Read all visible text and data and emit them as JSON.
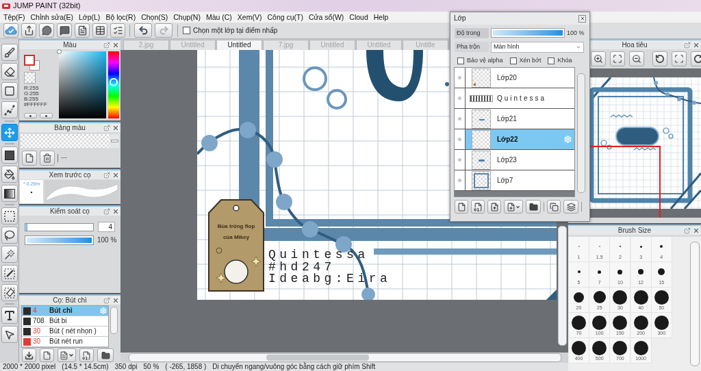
{
  "window": {
    "title": "JUMP PAINT (32bit)"
  },
  "menu": [
    "Tệp(F)",
    "Chỉnh sửa(E)",
    "Lớp(L)",
    "Bộ lọc(R)",
    "Chọn(S)",
    "Chụp(N)",
    "Màu (C)",
    "Xem(V)",
    "Công cụ(T)",
    "Cửa sổ(W)",
    "Cloud",
    "Help"
  ],
  "toolbar": {
    "buttons": [
      {
        "kind": "cloud"
      },
      {
        "kind": "share"
      },
      {
        "kind": "bubble"
      },
      {
        "kind": "comment"
      },
      {
        "kind": "page"
      },
      {
        "kind": "list"
      },
      {
        "kind": "checklist"
      }
    ],
    "undo": {
      "disabled": false
    },
    "redo": {
      "disabled": true
    },
    "pick_layer": {
      "label": "Chọn một lớp tại điểm nhấp",
      "checked": false
    }
  },
  "tools": [
    {
      "kind": "brush",
      "selected": false
    },
    {
      "kind": "eraser",
      "selected": false
    },
    {
      "kind": "shape",
      "selected": false
    },
    {
      "kind": "polyline",
      "selected": false
    },
    {
      "kind": "move",
      "selected": true
    },
    {
      "kind": "fill",
      "selected": false
    },
    {
      "kind": "bucket",
      "selected": false
    },
    {
      "kind": "gradient",
      "selected": false
    },
    {
      "kind": "marquee",
      "selected": false
    },
    {
      "kind": "lasso",
      "selected": false
    },
    {
      "kind": "wand",
      "selected": false
    },
    {
      "kind": "selpen",
      "selected": false
    },
    {
      "kind": "seleraser",
      "selected": false
    },
    {
      "kind": "text",
      "selected": false
    },
    {
      "kind": "operation",
      "selected": false
    }
  ],
  "color_panel": {
    "title": "Màu",
    "rgb": [
      "R:255",
      "G:255",
      "B:255"
    ],
    "hex": "#FFFFFF",
    "hue": {
      "level": 0.54
    }
  },
  "palette_panel": {
    "title": "Bảng màu",
    "name": "---"
  },
  "brush_preview": {
    "title": "Xem trước cọ",
    "size": "* 0.29m"
  },
  "brush_control": {
    "title": "Kiểm soát cọ",
    "size": {
      "level": 0.03,
      "value": "4"
    },
    "opacity": {
      "level": 1,
      "reading": "100 %"
    }
  },
  "brushes": {
    "title": "Cọ: Bút chì",
    "items": [
      {
        "color": "#2b2b2b",
        "size": "4",
        "size_flagged": true,
        "name": "Bút chì",
        "selected": true
      },
      {
        "color": "#2b2b2b",
        "size": "708",
        "size_flagged": false,
        "name": "Bút bi",
        "selected": false
      },
      {
        "color": "#2b2b2b",
        "size": "30",
        "size_flagged": true,
        "name": "Bút ( nét nhọn )",
        "selected": false
      },
      {
        "color": "#e53935",
        "size": "30",
        "size_flagged": true,
        "name": "Bút nét run",
        "selected": false
      }
    ]
  },
  "tabs": [
    {
      "label": "2.jpg",
      "selected": false
    },
    {
      "label": "Untitled",
      "selected": false
    },
    {
      "label": "Untitled",
      "selected": true
    },
    {
      "label": "7.jpg",
      "selected": false
    },
    {
      "label": "Untitled",
      "selected": false
    },
    {
      "label": "Untitled",
      "selected": false
    },
    {
      "label": "Untitle",
      "selected": false
    }
  ],
  "canvas": {
    "tag": [
      "Bùa trống flop",
      "của Mikey"
    ],
    "caption": [
      "Quintessa",
      "#hd247",
      "Ideabg:Eira"
    ]
  },
  "layers_window": {
    "title": "Lớp",
    "opacity": {
      "label": "Độ trong",
      "level": 1,
      "reading": "100 %"
    },
    "blend": {
      "label": "Pha trộn",
      "value": "Màn hình"
    },
    "options": [
      {
        "label": "Bảo vệ alpha",
        "checked": false
      },
      {
        "label": "Xén bớt",
        "checked": false
      },
      {
        "label": "Khóa",
        "checked": false
      }
    ],
    "layers": [
      {
        "kind": "raster",
        "name": "Lớp20",
        "selected": false
      },
      {
        "kind": "text",
        "name": "Quintessa",
        "selected": false
      },
      {
        "kind": "raster",
        "name": "Lớp21",
        "selected": false
      },
      {
        "kind": "raster",
        "name": "Lớp22",
        "selected": true
      },
      {
        "kind": "raster",
        "name": "Lớp23",
        "selected": false
      },
      {
        "kind": "raster",
        "name": "Lớp7",
        "selected": false
      }
    ]
  },
  "navigator": {
    "title": "Hoa tiêu"
  },
  "brush_size": {
    "title": "Brush Size",
    "sizes": [
      "1",
      "1.5",
      "2",
      "3",
      "4",
      "5",
      "7",
      "10",
      "12",
      "15",
      "20",
      "25",
      "30",
      "40",
      "50",
      "70",
      "100",
      "150",
      "200",
      "300",
      "400",
      "500",
      "700",
      "1000"
    ]
  },
  "status_bar": [
    "2000 * 2000 pixel",
    "(14.5 * 14.5cm)",
    "350 dpi",
    "50 %",
    "( -265, 1858 )",
    "Di chuyển ngang/vuông góc bằng cách giữ phím Shift"
  ]
}
